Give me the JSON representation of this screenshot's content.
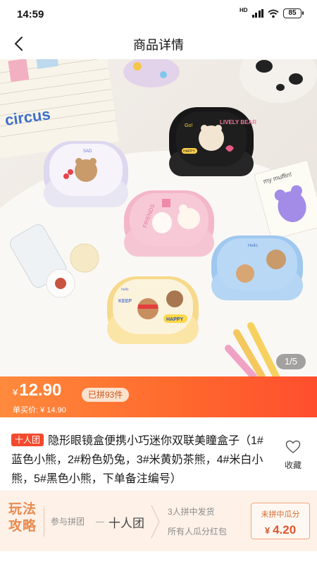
{
  "status_bar": {
    "time": "14:59",
    "network": "HD",
    "battery": "85"
  },
  "nav": {
    "title": "商品详情"
  },
  "gallery": {
    "pager": "1/5",
    "print_texts": {
      "circus": "circus",
      "lively_bear": "LIVELY BEAR",
      "go": "Go!",
      "happy": "HAPPY",
      "hello": "Hello",
      "my_muffin": "my muffin!",
      "keep": "KEEP",
      "happy2": "HAPPY",
      "friends": "FRIENDS",
      "hello2": "hello",
      "sad": "SAD"
    }
  },
  "price": {
    "currency": "¥",
    "group_price": "12.90",
    "sold_badge": "已拼93件",
    "single_price": "单买价: ¥ 14.90"
  },
  "product": {
    "tag": "十人团",
    "title": "隐形眼镜盒便携小巧迷你双联美瞳盒子（1#蓝色小熊，2#粉色奶兔，3#米黄奶茶熊，4#米白小熊，5#黑色小熊，下单备注编号）",
    "favorite_label": "收藏"
  },
  "gameplay": {
    "title": "玩法攻略",
    "join_label": "参与拼团",
    "team_size": "十人团",
    "rule_1": "3人拼中发货",
    "rule_2": "所有人瓜分红包",
    "bonus_label": "未拼中瓜分",
    "bonus_currency": "¥",
    "bonus_amount": "4.20"
  },
  "colors": {
    "price_gradient_start": "#ff8a3d",
    "price_gradient_end": "#ff4e2e",
    "tag_red": "#f24a2e",
    "gameplay_bg": "#fdf1e8",
    "gameplay_orange": "#e98a4e"
  }
}
